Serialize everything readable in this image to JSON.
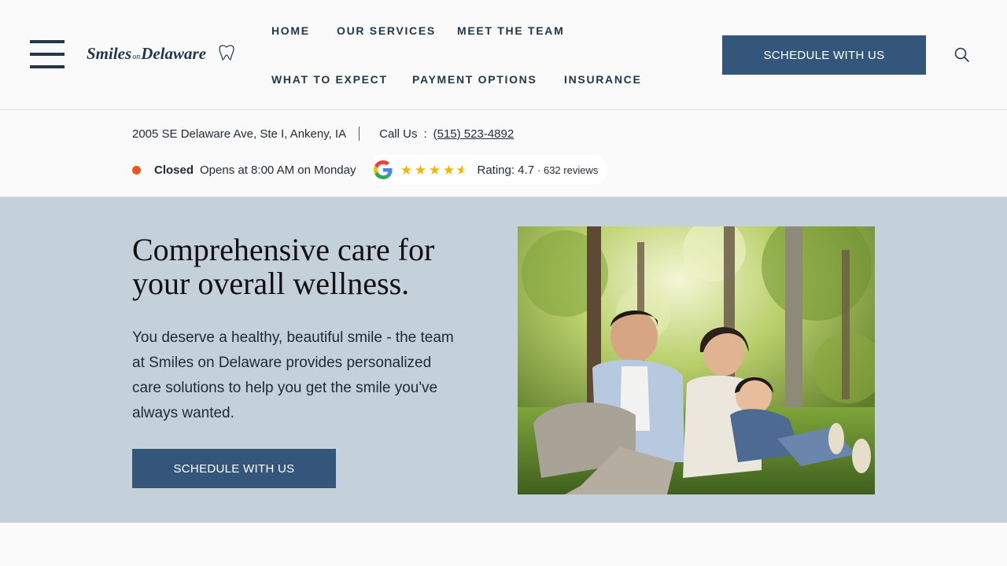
{
  "header": {
    "logo": {
      "part1": "Smiles",
      "part2": "on",
      "part3": "Delaware"
    },
    "nav": [
      {
        "label": "HOME"
      },
      {
        "label": "OUR SERVICES"
      },
      {
        "label": "MEET THE TEAM"
      },
      {
        "label": "WHAT TO EXPECT"
      },
      {
        "label": "PAYMENT OPTIONS"
      },
      {
        "label": "INSURANCE"
      }
    ],
    "cta_label": "SCHEDULE WITH US",
    "icons": {
      "menu": "hamburger-icon",
      "search": "search-icon"
    }
  },
  "info": {
    "address": "2005 SE Delaware Ave, Ste I, Ankeny, IA",
    "call_label": "Call Us",
    "call_sep": ":",
    "phone": "(515) 523-4892",
    "status": "Closed",
    "hours": "Opens at 8:00 AM on Monday",
    "rating_text": "Rating: 4.7",
    "reviews_text": "· 632 reviews",
    "rating_value": 4.7,
    "status_color": "#f0541e",
    "star_color": "#f4b400"
  },
  "hero": {
    "title": "Comprehensive care for your overall wellness.",
    "text": "You deserve a healthy, beautiful smile - the team at Smiles on Delaware provides personalized care solutions to help you get the smile you've always wanted.",
    "cta_label": "SCHEDULE WITH US",
    "background": "#c5d1da"
  },
  "colors": {
    "brand": "#22374b",
    "button": "#33567a"
  }
}
